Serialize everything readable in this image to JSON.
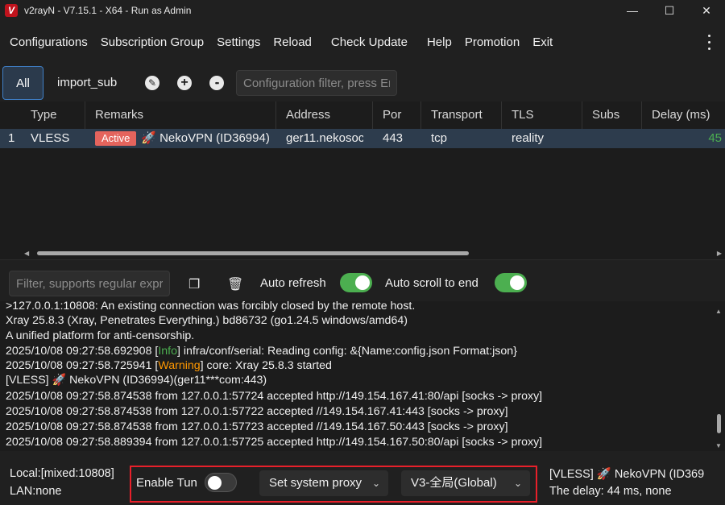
{
  "window": {
    "title": "v2rayN - V7.15.1 - X64 - Run as Admin",
    "logo_letter": "V",
    "minimize": "—",
    "maximize": "☐",
    "close": "✕"
  },
  "menu": {
    "items": [
      "Configurations",
      "Subscription Group",
      "Settings",
      "Reload",
      "Check Update",
      "Help",
      "Promotion",
      "Exit"
    ]
  },
  "toolbar": {
    "tab_all": "All",
    "tab_sub": "import_sub",
    "edit_icon": "✎",
    "add_icon": "+",
    "more_icon": "••",
    "filter_placeholder": "Configuration filter, press Enter to execute"
  },
  "grid": {
    "columns": [
      "Type",
      "Remarks",
      "Address",
      "Por",
      "Transport",
      "TLS",
      "Subs",
      "Delay (ms)"
    ],
    "rows": [
      {
        "index": "1",
        "type": "VLESS",
        "badge": "Active",
        "rocket": "🚀",
        "remarks": "NekoVPN (ID36994)",
        "address": "ger11.nekosoc",
        "port": "443",
        "transport": "tcp",
        "tls": "reality",
        "subs": "",
        "delay": "45"
      }
    ],
    "scroll_left": "◀",
    "scroll_right": "▶"
  },
  "logbar": {
    "filter_placeholder": "Filter, supports regular expressions",
    "copy_icon": "❐",
    "delete_icon": "🗑",
    "auto_refresh_label": "Auto refresh",
    "auto_refresh_on": true,
    "auto_scroll_label": "Auto scroll to end",
    "auto_scroll_on": true
  },
  "log": {
    "lines": [
      {
        "text": ">127.0.0.1:10808: An existing connection was forcibly closed by the remote host."
      },
      {
        "text": "Xray 25.8.3 (Xray, Penetrates Everything.) bd86732 (go1.24.5 windows/amd64)"
      },
      {
        "text": "A unified platform for anti-censorship."
      },
      {
        "pre": "2025/10/08 09:27:58.692908 [",
        "level": "Info",
        "level_class": "info",
        "post": "] infra/conf/serial: Reading config: &{Name:config.json Format:json}"
      },
      {
        "pre": "2025/10/08 09:27:58.725941 [",
        "level": "Warning",
        "level_class": "warn",
        "post": "] core: Xray 25.8.3 started"
      },
      {
        "text": "[VLESS] 🚀 NekoVPN (ID36994)(ger11***com:443)"
      },
      {
        "text": "2025/10/08 09:27:58.874538 from 127.0.0.1:57724 accepted http://149.154.167.41:80/api [socks -> proxy]"
      },
      {
        "text": "2025/10/08 09:27:58.874538 from 127.0.0.1:57722 accepted //149.154.167.41:443 [socks -> proxy]"
      },
      {
        "text": "2025/10/08 09:27:58.874538 from 127.0.0.1:57723 accepted //149.154.167.50:443 [socks -> proxy]"
      },
      {
        "text": "2025/10/08 09:27:58.889394 from 127.0.0.1:57725 accepted http://149.154.167.50:80/api [socks -> proxy]"
      }
    ],
    "scroll_up": "▲",
    "scroll_down": "▼"
  },
  "status": {
    "local": "Local:[mixed:10808]",
    "lan": "LAN:none",
    "enable_tun_label": "Enable Tun",
    "enable_tun_on": false,
    "system_proxy": "Set system proxy",
    "routing": "V3-全局(Global)",
    "chevron": "⌄",
    "current_server": "[VLESS] 🚀 NekoVPN (ID369",
    "delay": "The delay: 44 ms, none"
  },
  "colors": {
    "accent": "#3f7fc6",
    "active_badge": "#e4645d",
    "toggle_on": "#4caf50",
    "highlight_box": "#e8202a",
    "log_info": "#4caf50",
    "log_warning": "#ff9800"
  }
}
